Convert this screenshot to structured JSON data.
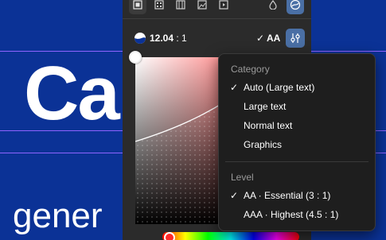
{
  "canvas": {
    "heading_text": "Ca",
    "body_text": "gener",
    "background_color": "#0b3296",
    "guide_color": "#8f63ff"
  },
  "panel": {
    "toolbar": {
      "icons": [
        "frame-icon",
        "pattern-icon",
        "film-icon",
        "image-icon",
        "video-icon",
        "drop-icon",
        "swirl-icon"
      ]
    },
    "contrast": {
      "ratio_value": "12.04",
      "ratio_suffix": " : 1",
      "wcag_check": "✓",
      "wcag_level": "AA"
    },
    "color": {
      "selected_hue": "#ff2a2a"
    }
  },
  "menu": {
    "category_label": "Category",
    "categories": [
      {
        "label": "Auto (Large text)",
        "selected": true
      },
      {
        "label": "Large text",
        "selected": false
      },
      {
        "label": "Normal text",
        "selected": false
      },
      {
        "label": "Graphics",
        "selected": false
      }
    ],
    "level_label": "Level",
    "levels": [
      {
        "label": "AA · Essential (3 : 1)",
        "selected": true
      },
      {
        "label": "AAA · Highest (4.5 : 1)",
        "selected": false
      }
    ],
    "check_glyph": "✓"
  }
}
